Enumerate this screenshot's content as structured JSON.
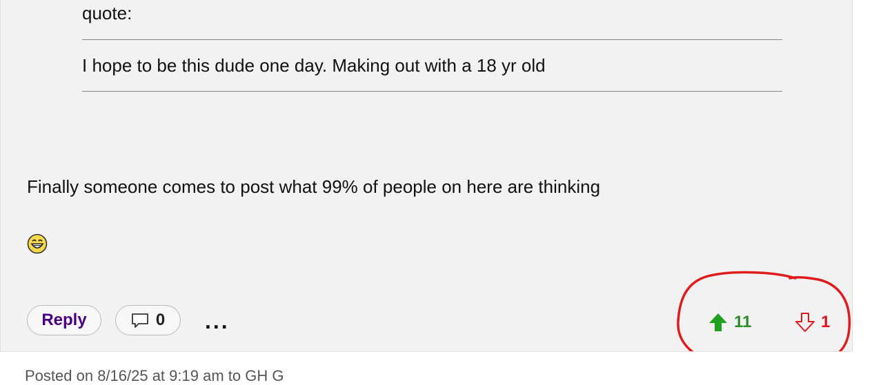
{
  "quote": {
    "label": "quote:",
    "text": "I hope to be this dude one day. Making out with a 18 yr old"
  },
  "post": {
    "body": "Finally someone comes to post what 99% of people on here are thinking",
    "emoji": "laughing-emoji-icon"
  },
  "actions": {
    "reply_label": "Reply",
    "comment_icon": "speech-bubble-icon",
    "comment_count": "0",
    "more_label": "...",
    "upvote_icon": "up-arrow-icon",
    "upvote_count": "11",
    "downvote_icon": "down-arrow-icon",
    "downvote_count": "1"
  },
  "colors": {
    "reply_text": "#4b0082",
    "upvote": "#2e8b2e",
    "downvote": "#e0141e",
    "annotation": "#e01b1b"
  },
  "next_post": {
    "meta": "Posted on 8/16/25 at 9:19 am to GH G"
  }
}
